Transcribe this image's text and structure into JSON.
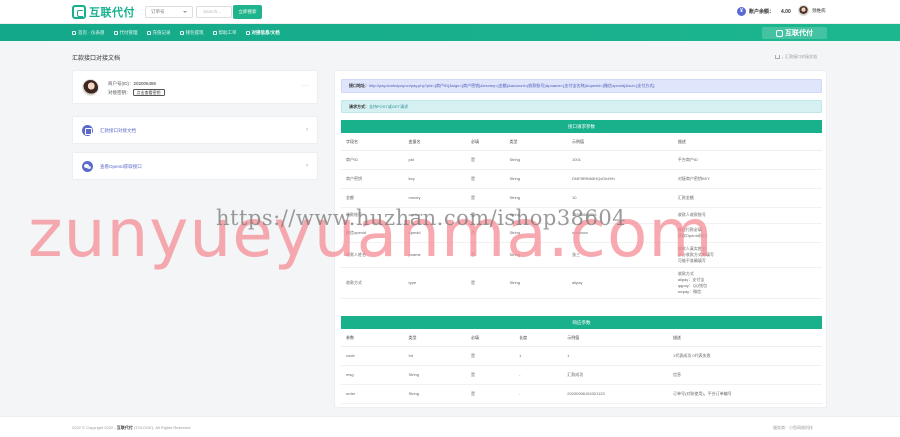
{
  "header": {
    "logo_text": "互联代付",
    "search_select": "订单号",
    "search_placeholder": "Search...",
    "search_button": "立即搜索",
    "balance_label": "账户余额：",
    "balance_value": "4.00",
    "user_name": "颈椎病"
  },
  "nav": {
    "items": [
      {
        "label": "首页 · 仪表盘",
        "icon": "home-icon"
      },
      {
        "label": "代付管理",
        "icon": "transfer-icon"
      },
      {
        "label": "充值记录",
        "icon": "chart-icon"
      },
      {
        "label": "钱包提现",
        "icon": "wallet-icon"
      },
      {
        "label": "帮助工单",
        "icon": "ticket-icon"
      },
      {
        "label": "对接信息/文档",
        "icon": "doc-icon",
        "active": true
      }
    ],
    "logo_right": "互联代付"
  },
  "page": {
    "title": "汇款接口对接文档",
    "breadcrumb": "汇款接口对接文档"
  },
  "profile": {
    "merchant_id_label": "商户号(ID)：",
    "merchant_id": "202006486",
    "key_label": "对接密钥：",
    "key_button": "点击查看密钥",
    "more": "···"
  },
  "links": [
    {
      "label": "汇款接口对接文档",
      "icon": "document-icon"
    },
    {
      "label": "查看OpenId获取接口",
      "icon": "wechat-icon"
    }
  ],
  "doc": {
    "address_label": "接口地址：",
    "address_value": "http://pay.duohuipay.cn/pay.php?pid={商户ID}&sign={商户密钥}&money={金额}&account={收款账号}&pname={支付宝名称}&openid={微信openid}&out={支付方式}",
    "method_label": "请求方式：",
    "method_value": "支持POST或GET请求",
    "request_title": "接口请求参数",
    "request_headers": [
      "字段名",
      "变量名",
      "必填",
      "类型",
      "示例值",
      "描述"
    ],
    "request_rows": [
      [
        "商户ID",
        "pid",
        "是",
        "String",
        "1001",
        "平台商户ID"
      ],
      [
        "商户密钥",
        "key",
        "是",
        "String",
        "Df4F8RfNb5HQvDh4Hh",
        "对接商户密钥KEY"
      ],
      [
        "金额",
        "money",
        "是",
        "String",
        "10",
        "汇款金额"
      ],
      [
        "收款账号",
        "account",
        "是",
        "String",
        "13588888888",
        "收款人收款账号"
      ],
      [
        "微信openid",
        "openid",
        "否",
        "String",
        "xxxxxxxx",
        "微信付款必填\n获取OpenId接口"
      ],
      [
        "收款人姓名",
        "pname",
        "否",
        "String",
        "张三",
        "收款人真实姓名\n部分收款方式需填写\n可能不准确填写"
      ],
      [
        "收款方式",
        "type",
        "是",
        "String",
        "alipay",
        "收款方式\nalipay：支付宝\nqqpay：QQ钱包\nwxpay：微信"
      ]
    ],
    "response_title": "响应参数",
    "response_headers": [
      "参数",
      "类型",
      "必填",
      "长度",
      "示例值",
      "描述"
    ],
    "response_rows": [
      [
        "code",
        "Int",
        "是",
        "1",
        "1",
        "1代表成功 0代表失败"
      ],
      [
        "msg",
        "String",
        "是",
        "-",
        "汇款成功",
        "信息"
      ],
      [
        "order",
        "String",
        "是",
        "-",
        "20200906154321123",
        "订单号(对账使用)，平台订单编号"
      ]
    ]
  },
  "footer": {
    "left_prefix": "2022 © Copyright 2022 - ",
    "left_brand": "互联代付",
    "left_suffix": " (TOLOOK). All Rights Reserved",
    "right": "服务商：小鱼网络科技"
  },
  "watermark": {
    "main": "zunyueyuanma.com",
    "url": "https://www.huzhan.com/ishop38604"
  }
}
